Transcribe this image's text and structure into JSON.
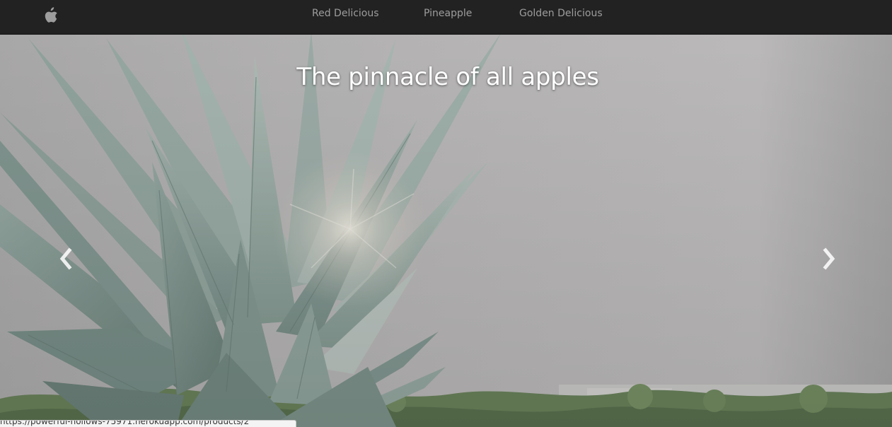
{
  "navbar": {
    "brand_icon": "apple-icon",
    "links": [
      {
        "label": "Red Delicious"
      },
      {
        "label": "Pineapple"
      },
      {
        "label": "Golden Delicious"
      }
    ]
  },
  "carousel": {
    "caption": "The pinnacle of all apples",
    "prev_icon": "chevron-left-icon",
    "next_icon": "chevron-right-icon"
  },
  "status_bar": {
    "url": "https://powerful-hollows-75971.herokuapp.com/products/2"
  },
  "colors": {
    "navbar_bg": "#222222",
    "nav_link": "#9d9d9d",
    "caption": "#ffffff"
  }
}
